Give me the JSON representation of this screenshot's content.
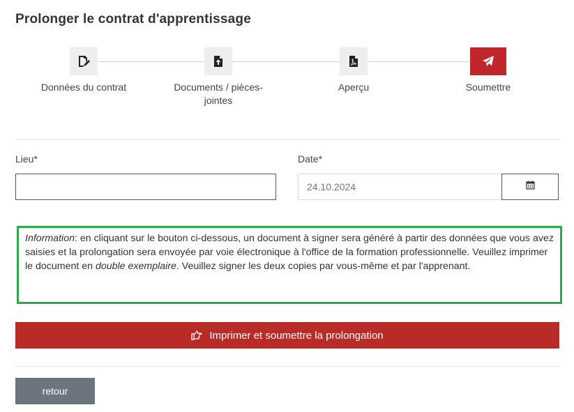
{
  "page": {
    "title": "Prolonger le contrat d'apprentissage"
  },
  "stepper": {
    "steps": [
      {
        "label": "Données du contrat",
        "icon": "edit-document-icon"
      },
      {
        "label": "Documents / pièces-jointes",
        "icon": "upload-document-icon"
      },
      {
        "label": "Aperçu",
        "icon": "pdf-document-icon"
      },
      {
        "label": "Soumettre",
        "icon": "paper-plane-icon"
      }
    ],
    "active_index": 3
  },
  "form": {
    "lieu": {
      "label": "Lieu*",
      "value": ""
    },
    "date": {
      "label": "Date*",
      "placeholder": "24.10.2024",
      "value": ""
    }
  },
  "info": {
    "prefix": "Information",
    "text_1": ": en cliquant sur le bouton ci-dessous, un document à signer sera généré à partir des données que vous avez saisies et la prolongation sera envoyée par voie électronique à l'office de la formation professionnelle. Veuillez imprimer le document en ",
    "emphasis": "double exemplaire",
    "text_2": ". Veuillez signer les deux copies par vous-même et par l'apprenant."
  },
  "actions": {
    "submit_label": "Imprimer et soumettre la prolongation",
    "back_label": "retour"
  },
  "colors": {
    "accent": "#c0272d",
    "submit": "#b92b27",
    "info_border": "#2ea84a",
    "back": "#6c757d"
  }
}
